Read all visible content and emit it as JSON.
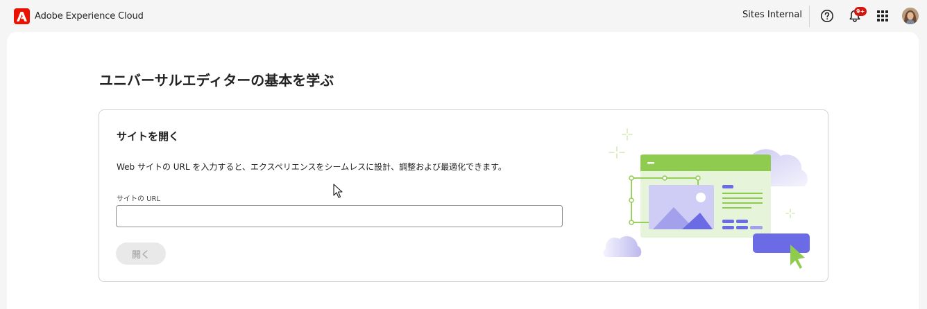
{
  "header": {
    "app_name": "Adobe Experience Cloud",
    "org_name": "Sites Internal",
    "notification_count": "9+",
    "icons": [
      "adobe-logo-icon",
      "help-icon",
      "bell-icon",
      "app-switcher-icon",
      "avatar"
    ]
  },
  "main": {
    "page_title": "ユニバーサルエディターの基本を学ぶ",
    "card": {
      "title": "サイトを開く",
      "description": "Web サイトの URL を入力すると、エクスペリエンスをシームレスに設計、調整および最適化できます。",
      "url_label": "サイトの URL",
      "url_value": "",
      "open_button": "開く"
    }
  },
  "colors": {
    "brand_red": "#eb1000",
    "badge_red": "#d31510",
    "illustration_green": "#8ecb4e",
    "illustration_purple": "#6b6be6"
  }
}
